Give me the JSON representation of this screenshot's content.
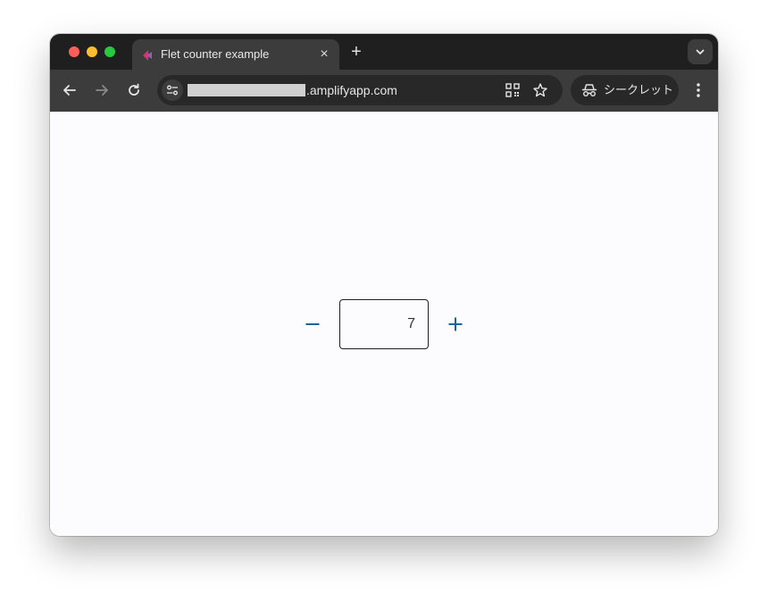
{
  "browser": {
    "tab": {
      "title": "Flet counter example",
      "close_symbol": "×",
      "favicon_icon": "flet-logo-icon"
    },
    "new_tab_symbol": "+",
    "address_bar": {
      "url_suffix": ".amplifyapp.com",
      "url_prefix_redacted": true
    },
    "incognito_label": "シークレット",
    "icons": {
      "back": "arrow-left-icon",
      "forward": "arrow-right-icon",
      "reload": "reload-icon",
      "site_info": "tune-icon",
      "qr": "qr-code-icon",
      "bookmark": "star-icon",
      "incognito": "incognito-icon",
      "menu": "kebab-menu-icon",
      "tab_search": "chevron-down-icon"
    }
  },
  "app": {
    "counter_value": "7",
    "decrement_icon": "minus-icon",
    "increment_icon": "plus-icon",
    "accent_color": "#1565a0"
  },
  "colors": {
    "tabstrip": "#1f1f1f",
    "toolbar": "#3c3c3c",
    "page_background": "#fcfcff"
  }
}
